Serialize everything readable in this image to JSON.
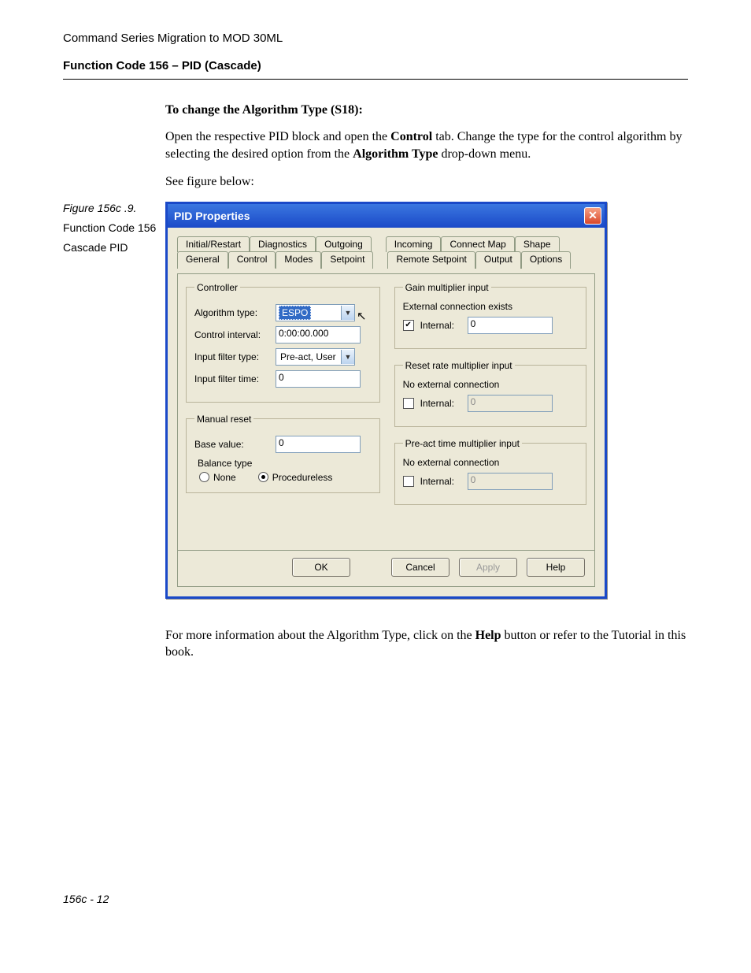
{
  "doc": {
    "header_title": "Command Series Migration to MOD 30ML",
    "section_title": "Function Code 156 – PID (Cascade)",
    "instr_title": "To change the Algorithm Type (S18):",
    "para1_pre": "Open the respective PID block and open the ",
    "para1_bold1": "Control",
    "para1_mid": " tab. Change the type for the control algorithm by selecting the desired option from the ",
    "para1_bold2": "Algorithm Type",
    "para1_post": " drop-down menu.",
    "para2": "See figure below:",
    "para3_pre": "For more information about the Algorithm Type, click on the ",
    "para3_bold": "Help",
    "para3_post": " button or refer to the Tutorial in this book.",
    "footer": "156c - 12"
  },
  "sidebar": {
    "figure_label": "Figure 156c .9.",
    "line1": "Function Code 156",
    "line2": "Cascade PID"
  },
  "dialog": {
    "title": "PID Properties",
    "tabs_row1": [
      "Initial/Restart",
      "Diagnostics",
      "Outgoing",
      "Incoming",
      "Connect Map",
      "Shape"
    ],
    "tabs_row2": [
      "General",
      "Control",
      "Modes",
      "Setpoint",
      "Remote Setpoint",
      "Output",
      "Options"
    ],
    "active_tab": "Control",
    "controller": {
      "legend": "Controller",
      "algorithm_label": "Algorithm type:",
      "algorithm_value": "ESPO",
      "interval_label": "Control interval:",
      "interval_value": "0:00:00.000",
      "filter_type_label": "Input filter type:",
      "filter_type_value": "Pre-act, User",
      "filter_time_label": "Input filter time:",
      "filter_time_value": "0"
    },
    "manual_reset": {
      "legend": "Manual reset",
      "base_label": "Base value:",
      "base_value": "0",
      "balance_label": "Balance type",
      "opt_none": "None",
      "opt_proc": "Procedureless"
    },
    "gain_group": {
      "legend": "Gain multiplier input",
      "status": "External connection exists",
      "internal_label": "Internal:",
      "internal_value": "0",
      "checked": true
    },
    "reset_group": {
      "legend": "Reset rate multiplier input",
      "status": "No external connection",
      "internal_label": "Internal:",
      "internal_value": "0",
      "checked": false
    },
    "preact_group": {
      "legend": "Pre-act time multiplier input",
      "status": "No external connection",
      "internal_label": "Internal:",
      "internal_value": "0",
      "checked": false
    },
    "buttons": {
      "ok": "OK",
      "cancel": "Cancel",
      "apply": "Apply",
      "help": "Help"
    }
  }
}
